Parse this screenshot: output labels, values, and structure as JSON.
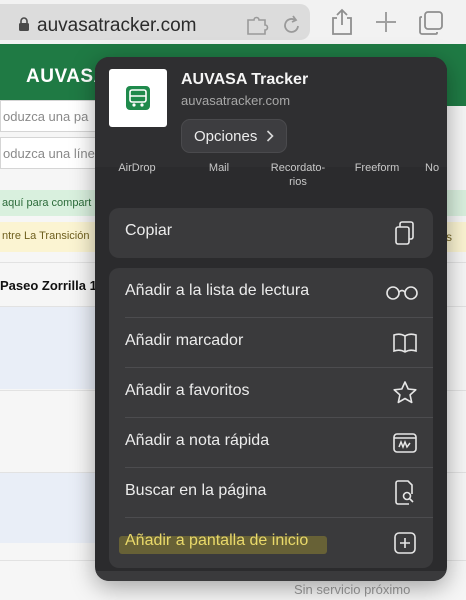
{
  "browser": {
    "url": "auvasatracker.com",
    "icons": [
      "lock-icon",
      "extension-icon",
      "reload-icon",
      "share-icon",
      "plus-icon",
      "tabs-icon"
    ]
  },
  "site": {
    "title": "AUVASA",
    "input_1": "oduzca una pa",
    "input_2": "oduzca una líne",
    "green_notice": "aquí para compart",
    "yellow_notice": "ntre La Transición",
    "yellow_notice_end": "s",
    "stop_name": "Paseo Zorrilla 1",
    "footer_status": "Sin servicio próximo",
    "colors": {
      "header": "#1f7a44",
      "green_notice": "#d9f0de",
      "yellow_notice": "#fbf4d2"
    }
  },
  "share_sheet": {
    "app_name": "AUVASA Tracker",
    "app_url": "auvasatracker.com",
    "options_label": "Opciones",
    "apps": [
      {
        "label": "AirDrop"
      },
      {
        "label": "Mail"
      },
      {
        "label": "Recordato-\nrios"
      },
      {
        "label": "Freeform"
      },
      {
        "label": "No"
      }
    ],
    "copy_label": "Copiar",
    "actions": [
      {
        "label": "Añadir a la lista de lectura",
        "icon": "glasses-icon"
      },
      {
        "label": "Añadir marcador",
        "icon": "book-icon"
      },
      {
        "label": "Añadir a favoritos",
        "icon": "star-icon"
      },
      {
        "label": "Añadir a nota rápida",
        "icon": "quick-note-icon"
      },
      {
        "label": "Buscar en la página",
        "icon": "find-in-page-icon"
      },
      {
        "label": "Añadir a pantalla de inicio",
        "icon": "add-square-icon",
        "highlighted": true
      }
    ]
  }
}
